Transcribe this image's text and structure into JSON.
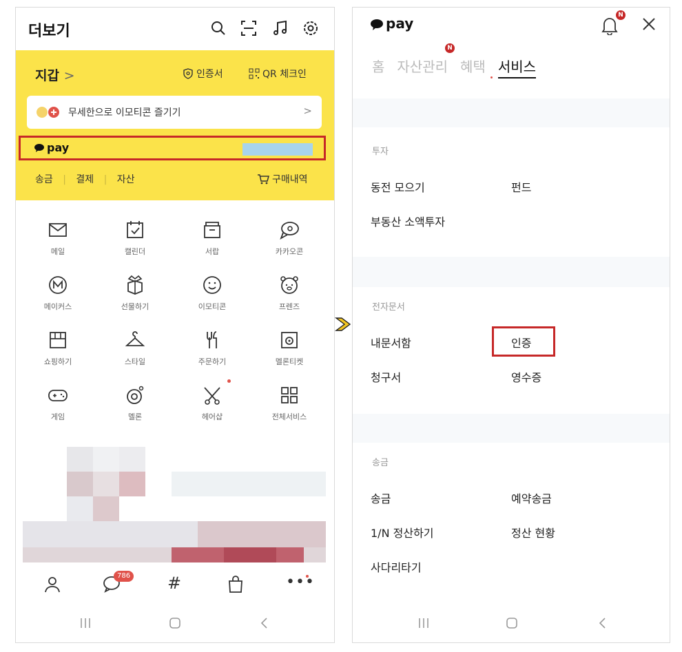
{
  "left": {
    "header": {
      "title": "더보기"
    },
    "wallet": {
      "title": "지갑",
      "chevron": ">",
      "auth_label": "인증서",
      "qr_label": "QR 체크인",
      "promo_text": "무세한으로 이모티콘 즐기기",
      "promo_chevron": ">",
      "pay_label": "pay",
      "tabs": [
        "송금",
        "결제",
        "자산"
      ],
      "purchase_label": "구매내역"
    },
    "grid": [
      {
        "label": "메일",
        "icon": "mail-icon"
      },
      {
        "label": "캘린더",
        "icon": "calendar-icon"
      },
      {
        "label": "서랍",
        "icon": "drawer-icon"
      },
      {
        "label": "카카오콘",
        "icon": "kakaocon-icon"
      },
      {
        "label": "메이커스",
        "icon": "makers-icon"
      },
      {
        "label": "선물하기",
        "icon": "gift-icon"
      },
      {
        "label": "이모티콘",
        "icon": "emoticon-icon"
      },
      {
        "label": "프렌즈",
        "icon": "friends-icon"
      },
      {
        "label": "쇼핑하기",
        "icon": "shopping-icon"
      },
      {
        "label": "스타일",
        "icon": "hanger-icon"
      },
      {
        "label": "주문하기",
        "icon": "order-icon"
      },
      {
        "label": "멜론티켓",
        "icon": "melon-ticket-icon"
      },
      {
        "label": "게임",
        "icon": "game-icon"
      },
      {
        "label": "멜론",
        "icon": "melon-icon"
      },
      {
        "label": "헤어샵",
        "icon": "scissors-icon"
      },
      {
        "label": "전체서비스",
        "icon": "all-services-icon"
      }
    ],
    "nav": {
      "chat_badge": "786"
    }
  },
  "right": {
    "header": {
      "pay_label": "pay",
      "bell_badge": "N"
    },
    "tabs": [
      {
        "label": "홈",
        "active": false
      },
      {
        "label": "자산관리",
        "active": false,
        "badge": "N"
      },
      {
        "label": "혜택",
        "active": false
      },
      {
        "label": "서비스",
        "active": true
      }
    ],
    "sections": [
      {
        "label": "투자",
        "items": [
          "동전 모으기",
          "펀드",
          "부동산 소액투자"
        ]
      },
      {
        "label": "전자문서",
        "items": [
          "내문서함",
          "인증",
          "청구서",
          "영수증"
        ]
      },
      {
        "label": "송금",
        "items": [
          "송금",
          "예약송금",
          "1/N 정산하기",
          "정산 현황",
          "사다리타기"
        ]
      }
    ]
  },
  "colors": {
    "wallet_yellow": "#fbe34a",
    "highlight_red": "#c62828",
    "badge_red": "#e0524a"
  }
}
